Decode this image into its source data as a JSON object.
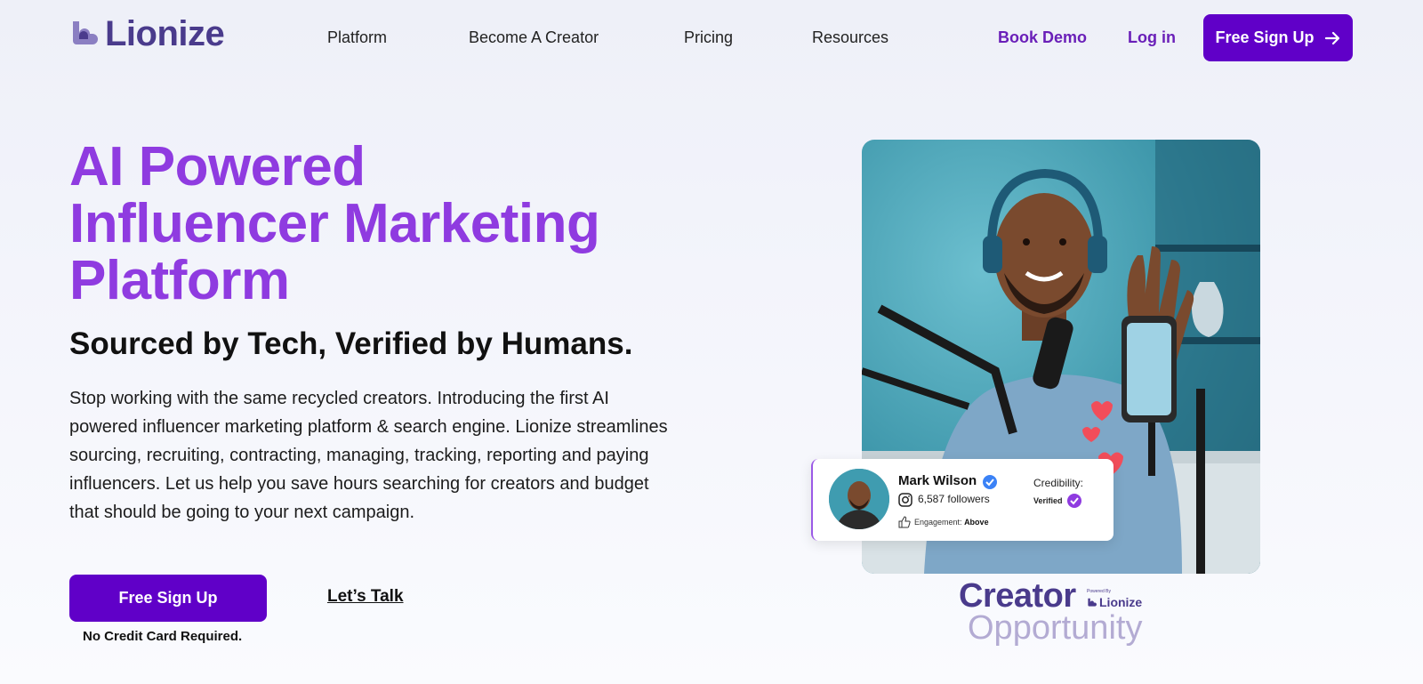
{
  "nav": {
    "logo_text": "Lionize",
    "links": [
      {
        "label": "Platform"
      },
      {
        "label": "Become A Creator"
      },
      {
        "label": "Pricing"
      },
      {
        "label": "Resources"
      }
    ],
    "book_demo": "Book Demo",
    "log_in": "Log in",
    "signup": "Free Sign Up"
  },
  "hero": {
    "title_lines": [
      "AI Powered",
      "Influencer Marketing",
      "Platform"
    ],
    "subtitle": "Sourced by Tech, Verified by Humans.",
    "body": "Stop working with the same recycled creators. Introducing the first AI powered influencer marketing platform & search engine. Lionize streamlines sourcing, recruiting, contracting, managing, tracking, reporting and paying influencers. Let us help you save hours searching for creators and budget that should be going to your next campaign.",
    "cta_signup": "Free Sign Up",
    "cta_talk": "Let’s Talk",
    "no_cc": "No Credit Card Required."
  },
  "profile_card": {
    "name": "Mark Wilson",
    "followers": "6,587 followers",
    "engagement_label": "Engagement:",
    "engagement_value": "Above",
    "credibility_label": "Credibility:",
    "credibility_value": "Verified"
  },
  "creator_logo": {
    "line1": "Creator",
    "line2": "Opportunity",
    "powered_by": "Powered By",
    "brand": "Lionize"
  },
  "colors": {
    "brand_purple": "#6000c8",
    "title_purple": "#8f3be0",
    "logo_indigo": "#4a3b8c"
  }
}
